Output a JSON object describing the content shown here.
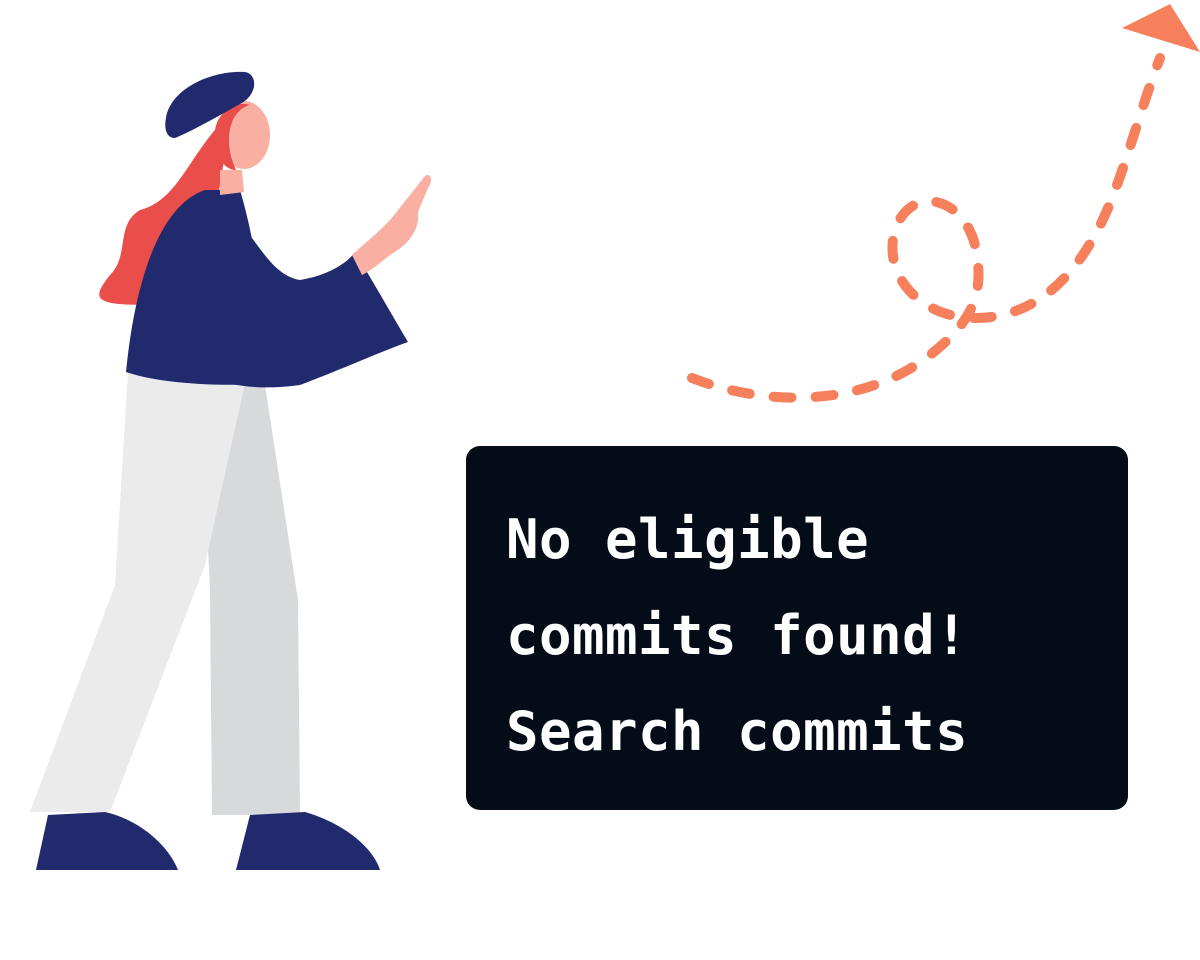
{
  "illustration": {
    "figure": "woman-pointing-icon",
    "arrow": "dashed-loop-arrow-icon"
  },
  "colors": {
    "background": "#ffffff",
    "card": "#040c17",
    "card_text": "#ffffff",
    "arrow": "#f7805c",
    "hair": "#e94e4b",
    "navy": "#222a6e",
    "skin": "#f9b0a3",
    "trousers": "#e9e9ea"
  },
  "message": {
    "lines": [
      "No eligible",
      "commits found!",
      "Search commits"
    ]
  }
}
